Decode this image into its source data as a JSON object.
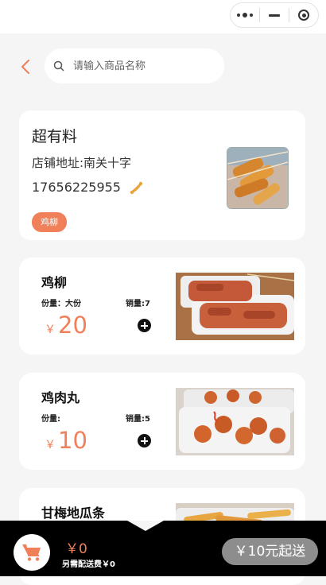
{
  "header": {
    "search_placeholder": "请输入商品名称",
    "icons": [
      "back-chevron-icon",
      "search-icon",
      "more-dots-icon",
      "minimize-icon",
      "close-target-icon"
    ]
  },
  "shop": {
    "name": "超有料",
    "address": "店铺地址:南关十字",
    "phone": "17656225955",
    "tag": "鸡柳"
  },
  "products": [
    {
      "name": "鸡柳",
      "spec": "份量：大份",
      "sales": "销量:7",
      "currency": "￥",
      "price": "20"
    },
    {
      "name": "鸡肉丸",
      "spec": "份量:",
      "sales": "销量:5",
      "currency": "￥",
      "price": "10"
    },
    {
      "name": "甘梅地瓜条"
    }
  ],
  "cart": {
    "total": "￥0",
    "delivery_fee": "另需配送费￥0",
    "checkout_label": "￥10元起送"
  },
  "colors": {
    "accent": "#f0805a",
    "background": "#f5f5f5",
    "bottom_bar": "#000000",
    "checkout_disabled": "#8d8d8d"
  }
}
